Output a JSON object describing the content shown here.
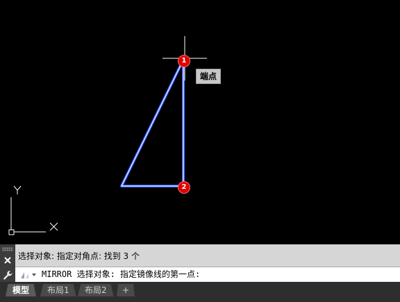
{
  "drawing": {
    "tooltip": "端点",
    "markers": [
      "1",
      "2"
    ],
    "ucs_labels": {
      "x": "X",
      "y": "Y"
    }
  },
  "command": {
    "history": "选择对象: 指定对角点: 找到 3 个",
    "current": "MIRROR 选择对象:  指定镜像线的第一点:"
  },
  "tabs": [
    {
      "label": "模型",
      "active": true
    },
    {
      "label": "布局1",
      "active": false
    },
    {
      "label": "布局2",
      "active": false
    },
    {
      "label": "+",
      "active": false
    }
  ],
  "colors": {
    "background": "#000000",
    "geometry": "#ffffff",
    "selection_glow": "#2f5bff",
    "marker": "#e00000",
    "crosshair": "#ffffff"
  },
  "icons": [
    "close-icon",
    "wrench-icon",
    "command-prompt-icon"
  ]
}
